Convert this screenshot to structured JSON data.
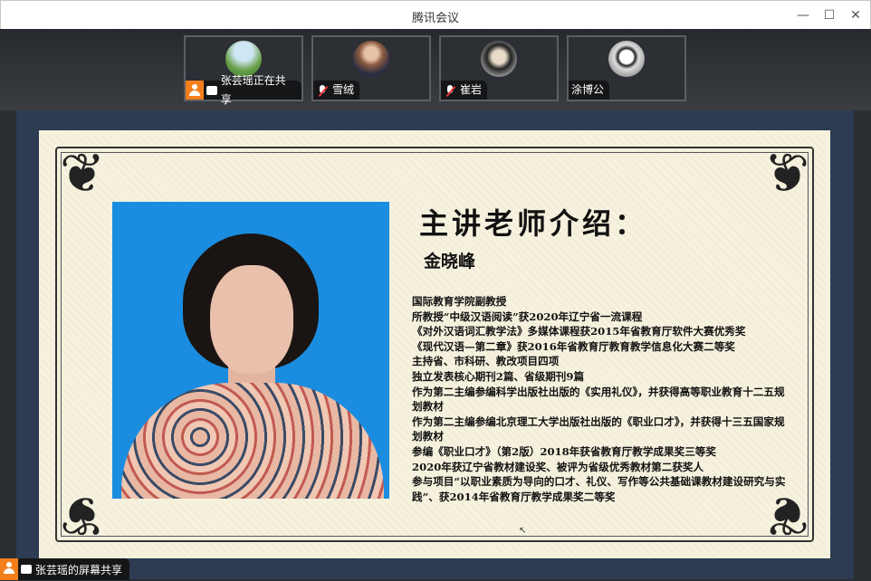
{
  "window": {
    "title": "腾讯会议",
    "minimize": "—",
    "maximize": "☐",
    "close": "✕"
  },
  "participants": [
    {
      "name": "张芸瑶正在共享",
      "sharing": true
    },
    {
      "name": "雪绒",
      "muted": true
    },
    {
      "name": "崔岩",
      "muted": true
    },
    {
      "name": "涂博公",
      "muted": false
    }
  ],
  "slide": {
    "heading": "主讲老师介绍：",
    "name": "金晓峰",
    "bio": [
      "国际教育学院副教授",
      "所教授“中级汉语阅读”获2020年辽宁省一流课程",
      "《对外汉语词汇教学法》多媒体课程获2015年省教育厅软件大赛优秀奖",
      "《现代汉语—第二章》获2016年省教育厅教育教学信息化大赛二等奖",
      "主持省、市科研、教改项目四项",
      "独立发表核心期刊2篇、省级期刊9篇",
      "作为第二主编参编科学出版社出版的《实用礼仪》，并获得高等职业教育十二五规划教材",
      "作为第二主编参编北京理工大学出版社出版的《职业口才》，并获得十三五国家规划教材",
      "参编《职业口才》（第2版）2018年获省教育厅教学成果奖三等奖",
      "2020年获辽宁省教材建设奖、被评为省级优秀教材第二获奖人",
      "参与项目“以职业素质为导向的口才、礼仪、写作等公共基础课教材建设研究与实践”、获2014年省教育厅教学成果奖二等奖"
    ]
  },
  "share_label": "张芸瑶的屏幕共享"
}
